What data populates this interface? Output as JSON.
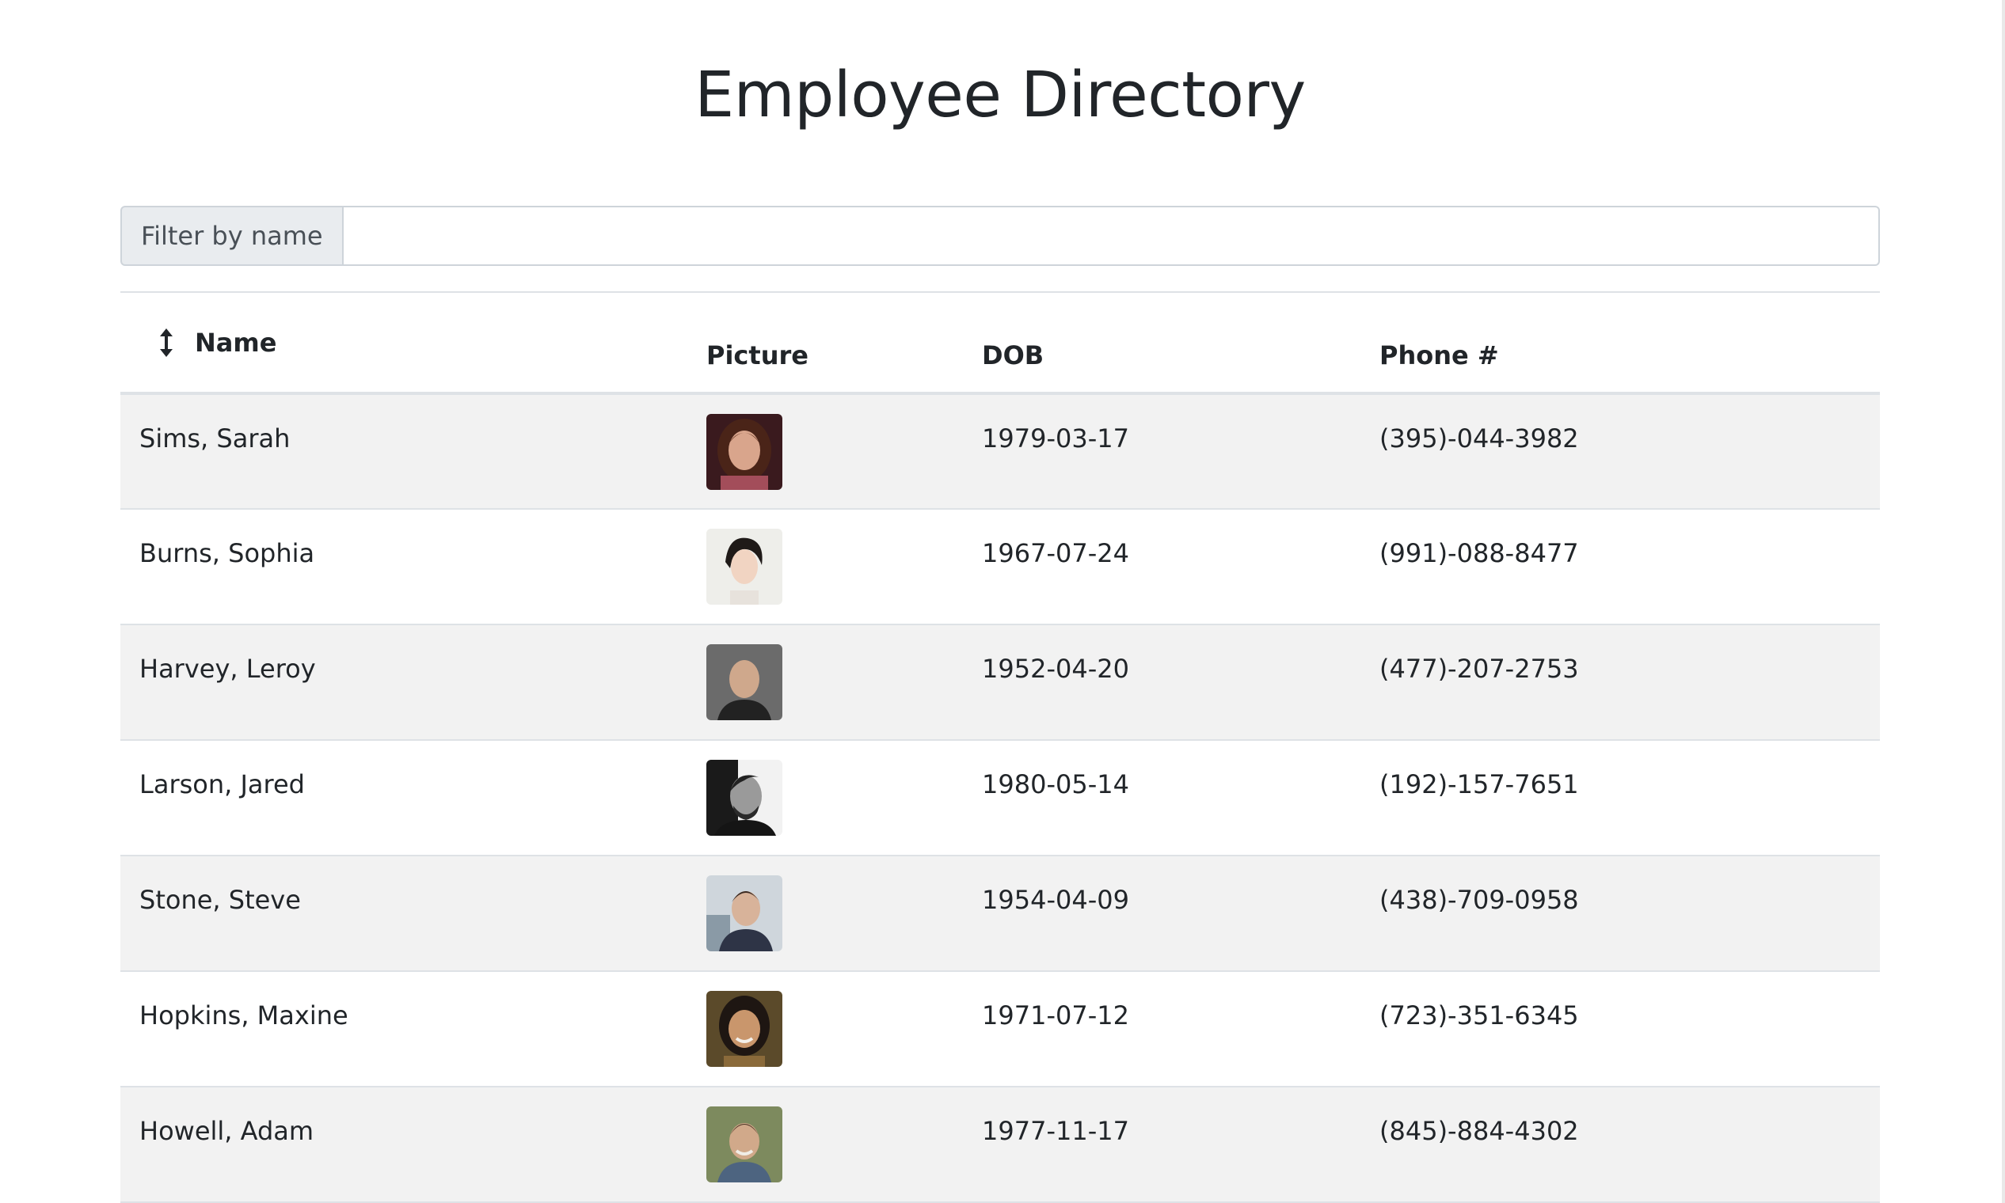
{
  "page": {
    "title": "Employee Directory"
  },
  "filter": {
    "label": "Filter by name",
    "value": "",
    "placeholder": ""
  },
  "table": {
    "headers": {
      "name": "Name",
      "picture": "Picture",
      "dob": "DOB",
      "phone": "Phone #"
    },
    "rows": [
      {
        "name": "Sims, Sarah",
        "dob": "1979-03-17",
        "phone": "(395)-044-3982"
      },
      {
        "name": "Burns, Sophia",
        "dob": "1967-07-24",
        "phone": "(991)-088-8477"
      },
      {
        "name": "Harvey, Leroy",
        "dob": "1952-04-20",
        "phone": "(477)-207-2753"
      },
      {
        "name": "Larson, Jared",
        "dob": "1980-05-14",
        "phone": "(192)-157-7651"
      },
      {
        "name": "Stone, Steve",
        "dob": "1954-04-09",
        "phone": "(438)-709-0958"
      },
      {
        "name": "Hopkins, Maxine",
        "dob": "1971-07-12",
        "phone": "(723)-351-6345"
      },
      {
        "name": "Howell, Adam",
        "dob": "1977-11-17",
        "phone": "(845)-884-4302"
      }
    ]
  },
  "icons": {
    "sort": "sort-vertical-icon"
  }
}
